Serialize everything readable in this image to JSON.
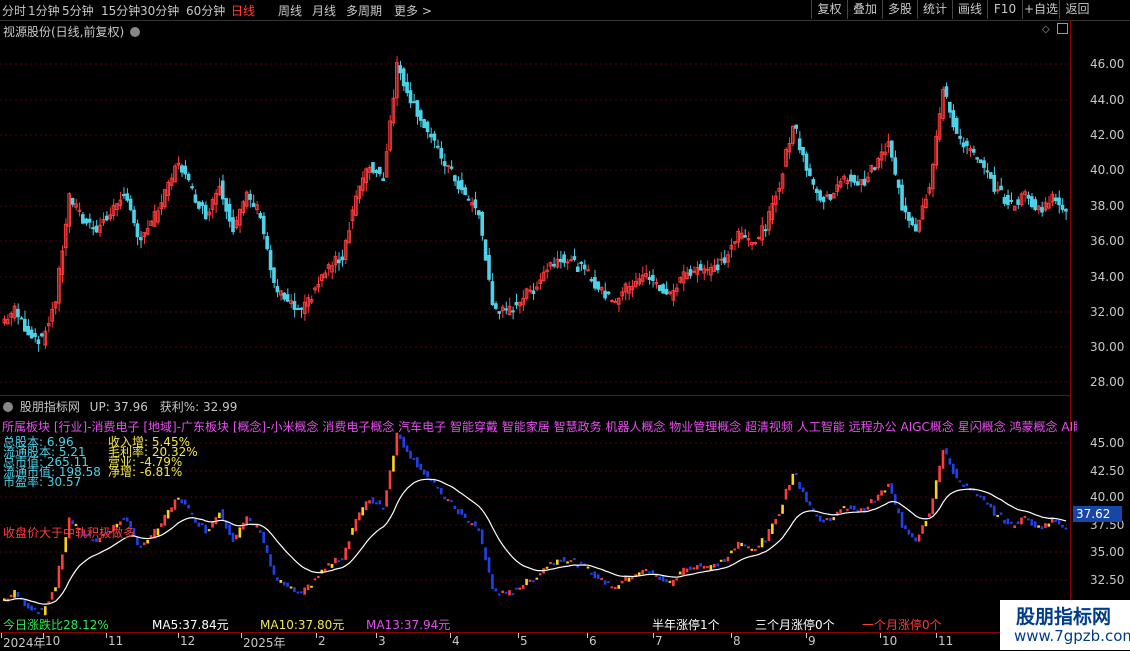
{
  "toolbar": {
    "periods": [
      {
        "label": "分时",
        "active": false
      },
      {
        "label": "1分钟",
        "active": false
      },
      {
        "label": "5分钟",
        "active": false
      },
      {
        "label": "15分钟",
        "active": false
      },
      {
        "label": "30分钟",
        "active": false
      },
      {
        "label": "60分钟",
        "active": false
      },
      {
        "label": "日线",
        "active": true
      },
      {
        "label": "周线",
        "active": false
      },
      {
        "label": "月线",
        "active": false
      },
      {
        "label": "多周期",
        "active": false
      },
      {
        "label": "更多 >",
        "active": false
      }
    ],
    "right_buttons": [
      "复权",
      "叠加",
      "多股",
      "统计",
      "画线",
      "F10",
      "+自选",
      "返回"
    ]
  },
  "main_chart": {
    "title": "视源股份(日线,前复权)",
    "y_ticks": [
      "46.00",
      "44.00",
      "42.00",
      "40.00",
      "38.00",
      "36.00",
      "34.00",
      "32.00",
      "30.00",
      "28.00"
    ]
  },
  "indicator_panel": {
    "title": "股朋指标网",
    "up_text": "UP: 37.96",
    "profit_text": "获利%: 32.99",
    "concepts": "所属板块 [行业]-消费电子 [地域]-广东板块 [概念]-小米概念 消费电子概念 汽车电子 智能穿戴 智能家居 智慧政务 机器人概念 物业管理概念 超清视频 人工智能 远程办公 AIGC概念 星闪概念 鸿蒙概念 AI眼镜 Dee",
    "left_stats": [
      "总股本: 6.96",
      "流通股本: 5.21",
      "总市值: 265.11",
      "流通市值: 198.58",
      "市盈率: 30.57"
    ],
    "right_stats": [
      "收入增: 5.45%",
      "毛利率: 20.32%",
      "营业: -4.79%",
      "净增: -6.81%"
    ],
    "note": "收盘价大于中轨积极做多",
    "y_ticks": [
      "45.00",
      "42.50",
      "40.00",
      "37.50",
      "35.00",
      "32.50"
    ],
    "price_tag": "37.62",
    "ratio": "今日涨跌比28.12%",
    "ma5": "MA5:37.84元",
    "ma10": "MA10:37.80元",
    "ma13": "MA13:37.94元",
    "limit_half": "半年涨停1个",
    "limit_three": "三个月涨停0个",
    "limit_one": "一个月涨停0个"
  },
  "date_axis": {
    "labels": [
      "2024年",
      "10",
      "11",
      "12",
      "2025年",
      "2",
      "3",
      "4",
      "5",
      "6",
      "7",
      "8",
      "9",
      "10",
      "11"
    ]
  },
  "watermark": {
    "line1": "股朋指标网",
    "line2": "www.7gpzb.com"
  },
  "chart_data": {
    "type": "candlestick",
    "title": "视源股份(日线,前复权)",
    "ylim": [
      27.5,
      47.2
    ],
    "close_series": [
      31.5,
      32.2,
      31.0,
      30.5,
      32.8,
      38.5,
      37.2,
      36.8,
      37.5,
      38.8,
      36.2,
      37.0,
      38.6,
      40.5,
      38.8,
      37.5,
      39.2,
      36.8,
      38.5,
      37.6,
      33.5,
      32.6,
      32.0,
      33.4,
      34.6,
      35.2,
      38.6,
      40.2,
      39.6,
      45.8,
      44.0,
      42.5,
      41.0,
      39.8,
      38.5,
      37.6,
      32.5,
      32.0,
      32.8,
      33.4,
      34.6,
      35.2,
      34.8,
      34.2,
      33.2,
      32.8,
      33.6,
      34.2,
      33.6,
      33.0,
      34.2,
      34.6,
      34.4,
      35.0,
      36.4,
      36.0,
      36.8,
      39.2,
      42.6,
      40.2,
      38.2,
      38.8,
      39.6,
      39.2,
      40.2,
      41.4,
      38.0,
      36.8,
      39.2,
      44.4,
      42.0,
      41.0,
      40.0,
      38.8,
      38.0,
      38.6,
      37.8,
      38.4,
      37.9
    ]
  }
}
